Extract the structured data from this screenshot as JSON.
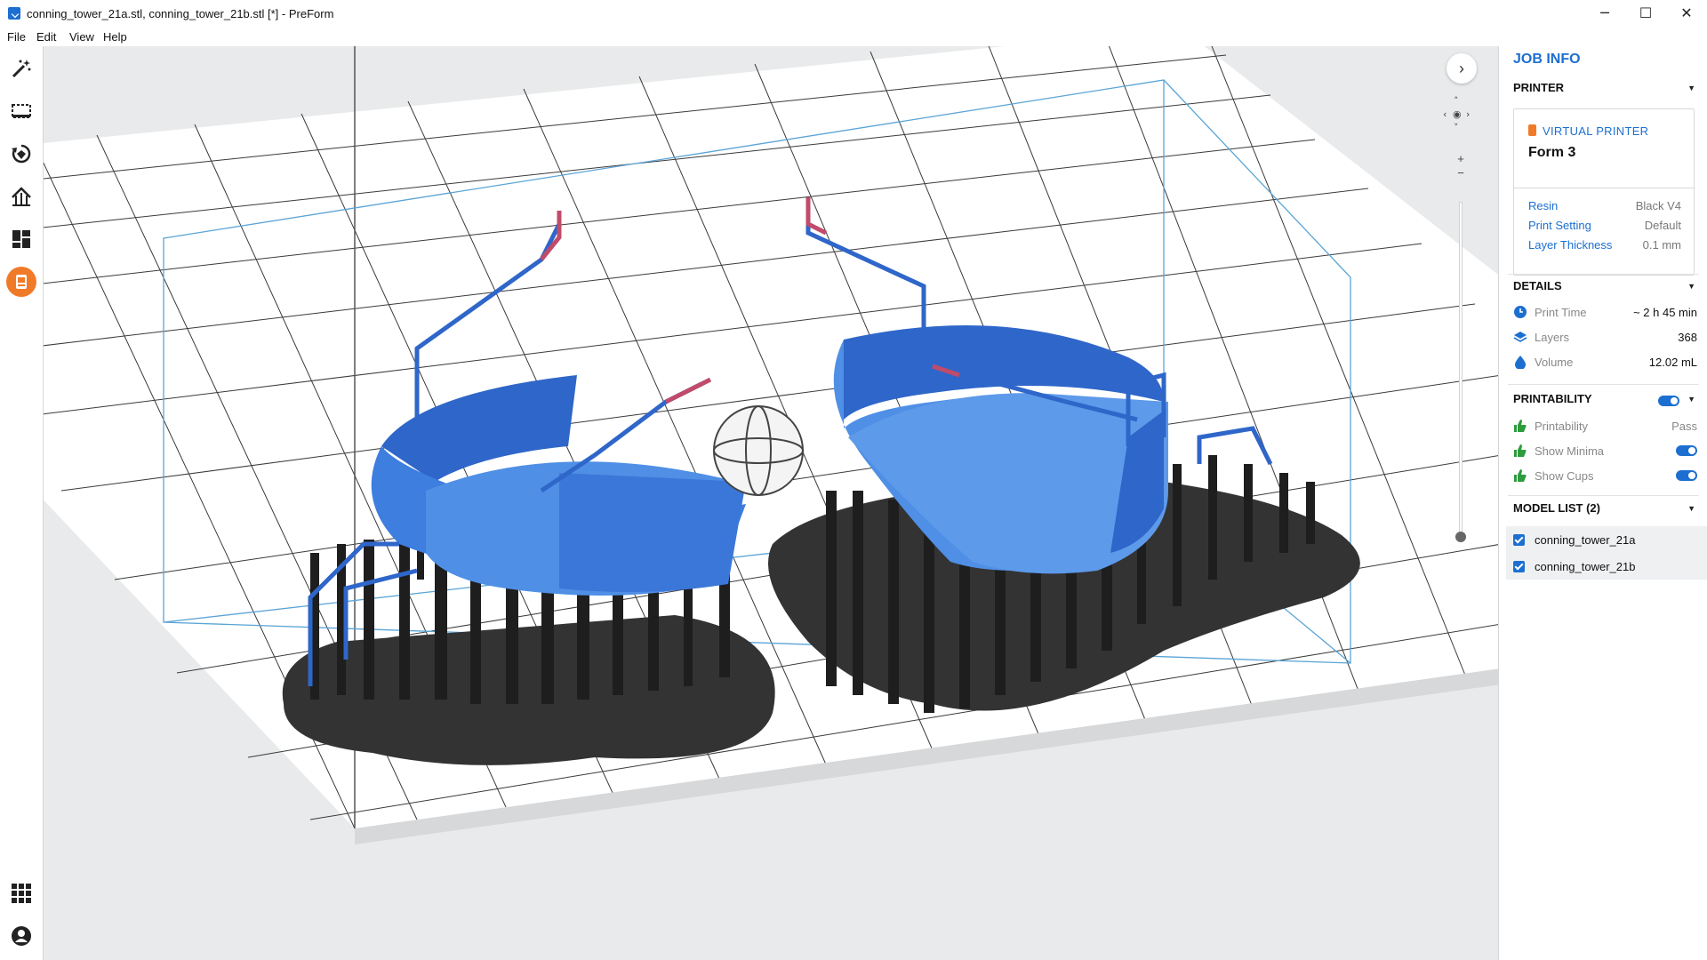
{
  "window": {
    "title": "conning_tower_21a.stl, conning_tower_21b.stl [*] - PreForm",
    "minimize": "─",
    "maximize": "☐",
    "close": "✕"
  },
  "menu": [
    "File",
    "Edit",
    "View",
    "Help"
  ],
  "toolbar": {
    "tools": [
      "magic-wand-icon",
      "select-icon",
      "orientation-icon",
      "supports-icon",
      "layout-icon",
      "job-info-icon"
    ],
    "bottom": [
      "apps-grid-icon",
      "account-icon"
    ],
    "active": "job-info-icon"
  },
  "viewport": {
    "expand_arrow": "›",
    "nav": {
      "up": "˄",
      "down": "˅",
      "left": "‹",
      "right": "›",
      "center": "◉"
    },
    "zoom_in": "+",
    "zoom_out": "−",
    "model_fill": "#3a7ad9",
    "support_fill": "#2b2b2b"
  },
  "panel": {
    "title": "JOB INFO",
    "printer": {
      "header": "PRINTER",
      "type_label": "VIRTUAL PRINTER",
      "model": "Form 3",
      "rows": [
        {
          "key": "Resin",
          "value": "Black V4"
        },
        {
          "key": "Print Setting",
          "value": "Default"
        },
        {
          "key": "Layer Thickness",
          "value": "0.1 mm"
        }
      ]
    },
    "details": {
      "header": "DETAILS",
      "rows": [
        {
          "label": "Print Time",
          "value": "~ 2 h 45 min"
        },
        {
          "label": "Layers",
          "value": "368"
        },
        {
          "label": "Volume",
          "value": "12.02 mL"
        }
      ]
    },
    "printability": {
      "header": "PRINTABILITY",
      "rows": [
        {
          "label": "Printability",
          "value": "Pass"
        },
        {
          "label": "Show Minima",
          "value": ""
        },
        {
          "label": "Show Cups",
          "value": ""
        }
      ]
    },
    "model_list": {
      "header": "MODEL LIST (2)",
      "items": [
        "conning_tower_21a",
        "conning_tower_21b"
      ]
    },
    "accent": "#1c6fd1",
    "good": "#2e9b3e"
  }
}
